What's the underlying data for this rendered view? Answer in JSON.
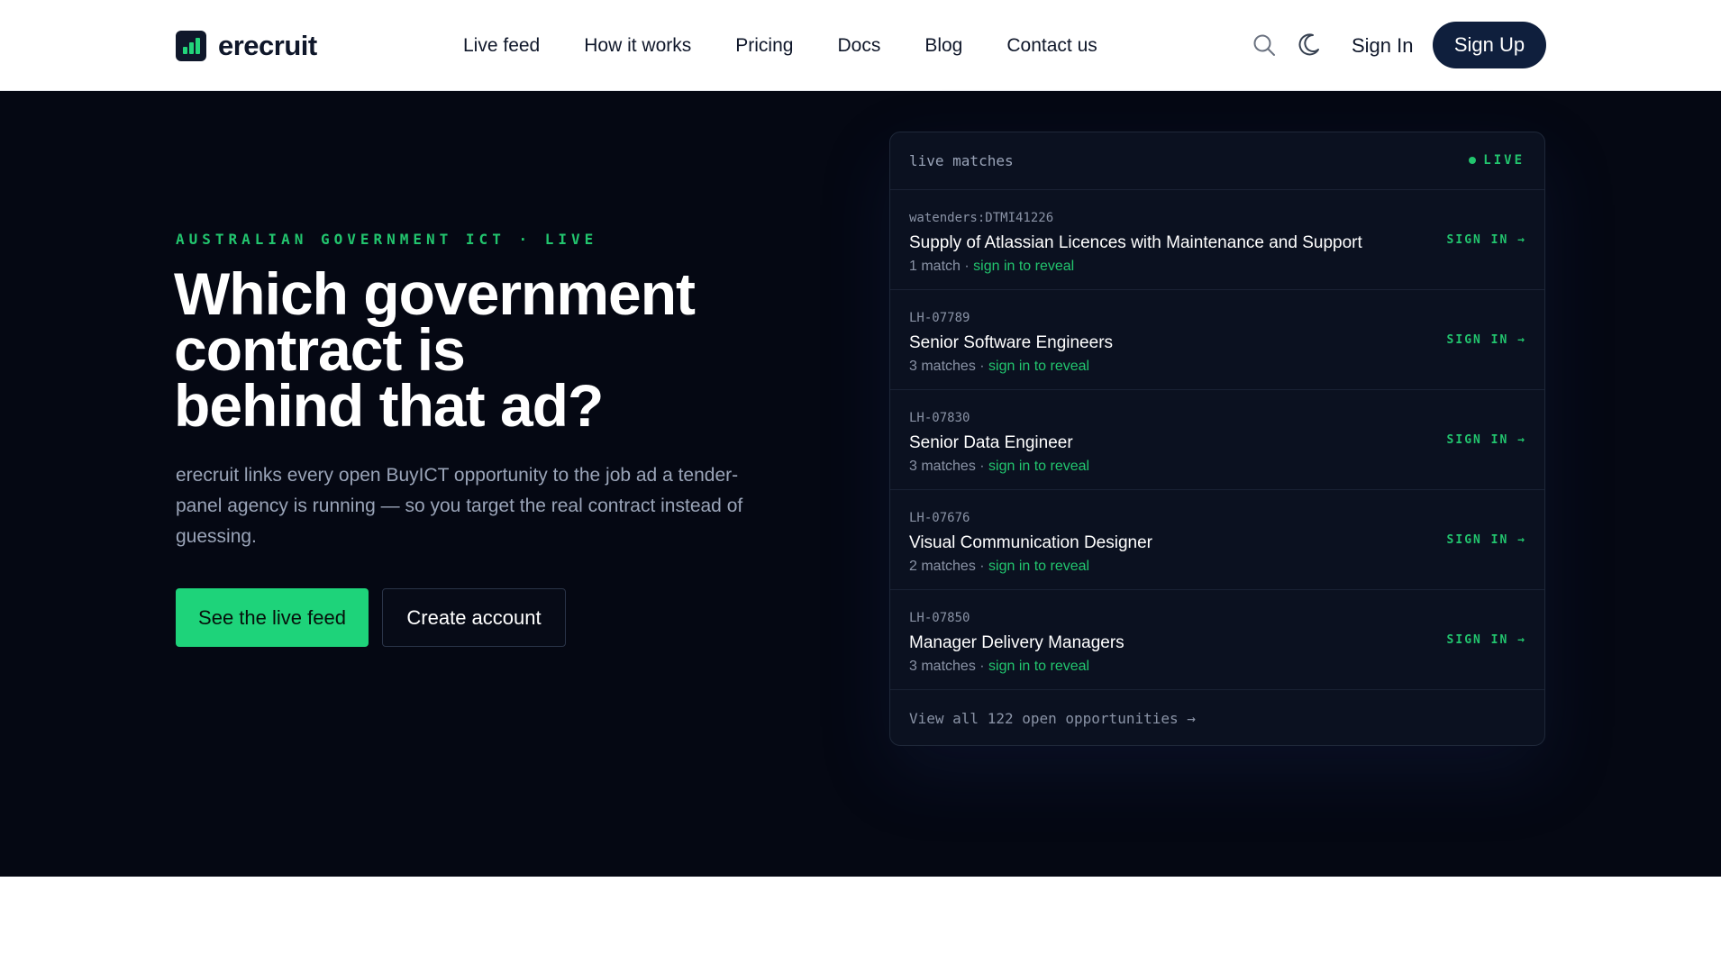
{
  "brand": {
    "name": "erecruit"
  },
  "nav": {
    "items": [
      {
        "label": "Live feed"
      },
      {
        "label": "How it works"
      },
      {
        "label": "Pricing"
      },
      {
        "label": "Docs"
      },
      {
        "label": "Blog"
      },
      {
        "label": "Contact us"
      }
    ],
    "sign_in": "Sign In",
    "sign_up": "Sign Up"
  },
  "hero": {
    "eyebrow": "AUSTRALIAN GOVERNMENT ICT · LIVE",
    "headline": [
      "Which government",
      "contract is",
      "behind that ad?"
    ],
    "subtext": "erecruit links every open BuyICT opportunity to the job ad a tender-panel agency is running — so you target the real contract instead of guessing.",
    "primary_cta": "See the live feed",
    "secondary_cta": "Create account"
  },
  "panel": {
    "title": "live matches",
    "live_label": "LIVE",
    "rows": [
      {
        "id": "watenders:DTMI41226",
        "title": "Supply of Atlassian Licences with Maintenance and Support",
        "matches": "1 match",
        "separator": " · ",
        "reveal": "sign in to reveal",
        "cta": "SIGN IN →"
      },
      {
        "id": "LH-07789",
        "title": "Senior Software Engineers",
        "matches": "3 matches",
        "separator": " · ",
        "reveal": "sign in to reveal",
        "cta": "SIGN IN →"
      },
      {
        "id": "LH-07830",
        "title": "Senior Data Engineer",
        "matches": "3 matches",
        "separator": " · ",
        "reveal": "sign in to reveal",
        "cta": "SIGN IN →"
      },
      {
        "id": "LH-07676",
        "title": "Visual Communication Designer",
        "matches": "2 matches",
        "separator": " · ",
        "reveal": "sign in to reveal",
        "cta": "SIGN IN →"
      },
      {
        "id": "LH-07850",
        "title": "Manager Delivery Managers",
        "matches": "3 matches",
        "separator": " · ",
        "reveal": "sign in to reveal",
        "cta": "SIGN IN →"
      }
    ],
    "footer_link": "View all 122 open opportunities →"
  },
  "colors": {
    "accent": "#1ed37a",
    "hero_bg": "#050813",
    "signup_bg": "#0f1f3d"
  },
  "icons": [
    "logo-bars-icon",
    "search-icon",
    "moon-icon",
    "live-dot-icon"
  ]
}
